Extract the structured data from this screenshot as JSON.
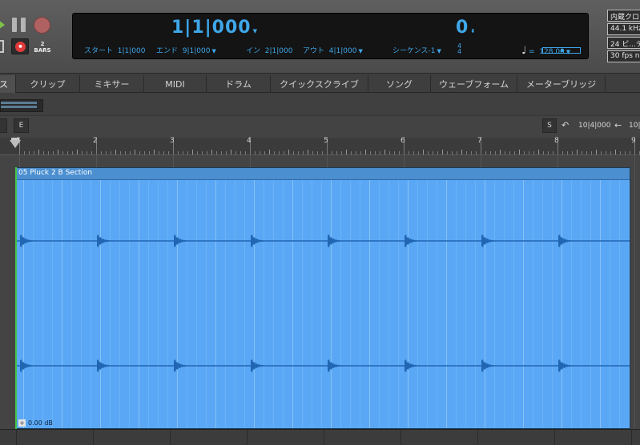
{
  "transport": {
    "bars_value": "2",
    "bars_label": "BARS",
    "position": "1|1|000",
    "start_label": "スタート",
    "start_value": "1|1|000",
    "end_label": "エンド",
    "end_value": "9|1|000",
    "in_label": "イン",
    "in_value": "2|1|000",
    "out_label": "アウト",
    "out_value": "4|1|000",
    "counter": "0",
    "sequence": "シーケンス-1",
    "timesig_top": "4",
    "timesig_bottom": "4",
    "tempo_note": "♩",
    "tempo_eq": "=",
    "tempo": "128.00",
    "status_items": [
      "内蔵クロ",
      "44.1 kHz",
      "24 ビ...テ",
      "30 fps nc"
    ]
  },
  "tabs": [
    {
      "label": "ス",
      "selected": true
    },
    {
      "label": "クリップ",
      "selected": false
    },
    {
      "label": "ミキサー",
      "selected": false
    },
    {
      "label": "MIDI",
      "selected": false
    },
    {
      "label": "ドラム",
      "selected": false
    },
    {
      "label": "クイックスクライブ",
      "selected": false
    },
    {
      "label": "ソング",
      "selected": false
    },
    {
      "label": "ウェーブフォーム",
      "selected": false
    },
    {
      "label": "メーターブリッジ",
      "selected": false
    }
  ],
  "toolbar": {
    "e_button": "E",
    "s_button": "S",
    "undo_icon": "undo-icon",
    "nav_value_1": "10|4|000",
    "back_icon": "arrow-left-icon",
    "nav_value_2": "10|"
  },
  "ruler": {
    "labels": [
      "1",
      "2",
      "3",
      "4",
      "5",
      "6",
      "7",
      "8",
      "9"
    ]
  },
  "clip": {
    "name": "05 Pluck 2 B Section",
    "gain_icon": "+",
    "gain": "0.00 dB",
    "color": "#5aa8f5",
    "waveform_color": "#2166b3"
  },
  "colors": {
    "accent": "#3fa7e9",
    "play": "#7ec24a",
    "record": "#e03a3a",
    "start_marker": "#47c444"
  }
}
